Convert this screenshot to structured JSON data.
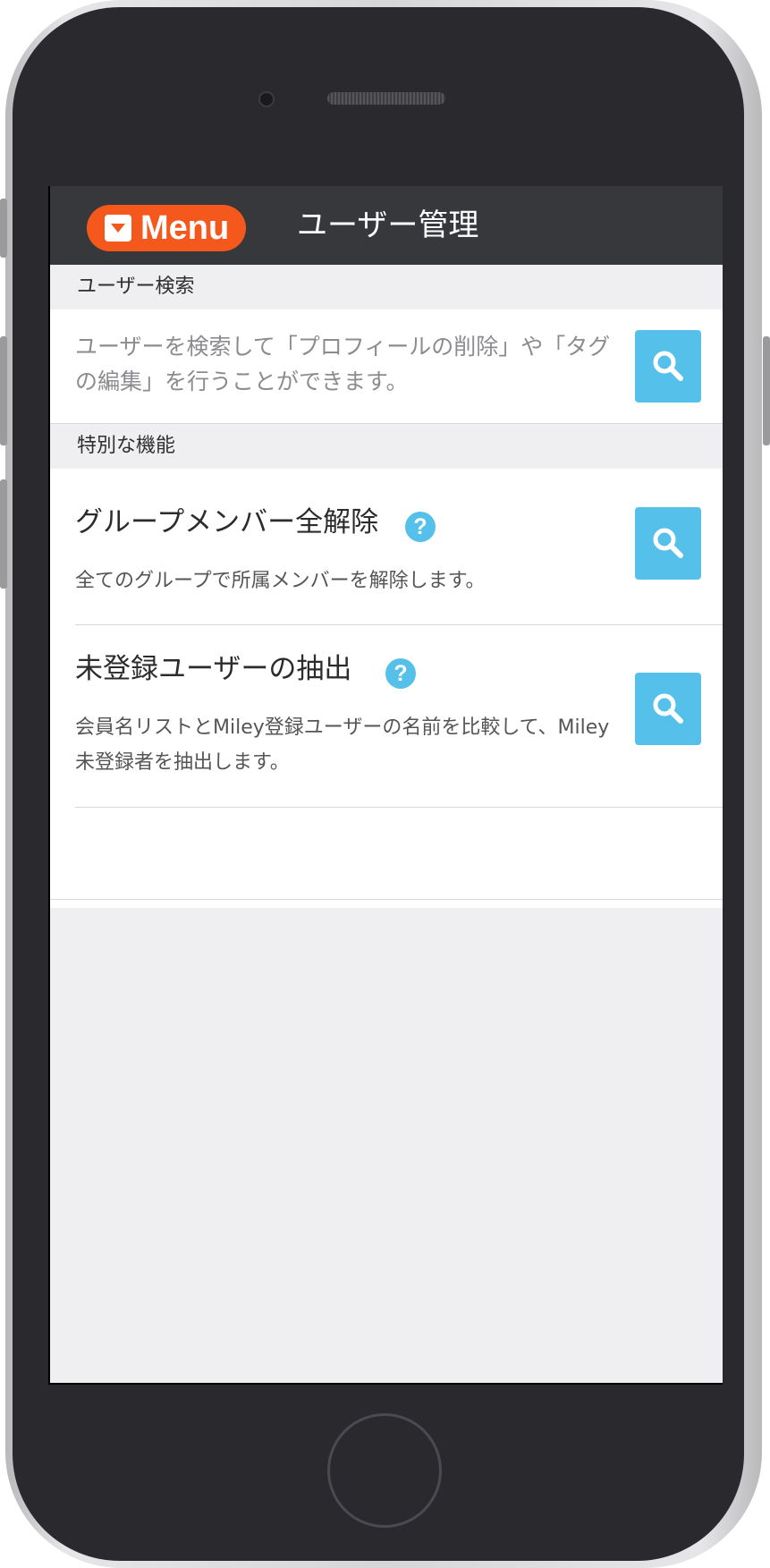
{
  "header": {
    "menu_label": "Menu",
    "title": "ユーザー管理"
  },
  "sections": {
    "user_search": {
      "heading": "ユーザー検索",
      "description": "ユーザーを検索して「プロフィールの削除」や「タグの編集」を行うことができます。"
    },
    "special": {
      "heading": "特別な機能",
      "items": [
        {
          "title": "グループメンバー全解除",
          "description": "全てのグループで所属メンバーを解除します。"
        },
        {
          "title": "未登録ユーザーの抽出",
          "description": "会員名リストとMiley登録ユーザーの名前を比較して、Miley未登録者を抽出します。"
        }
      ]
    }
  },
  "icons": {
    "help_glyph": "?",
    "menu": "chevron-down-square-icon",
    "search": "search-icon"
  },
  "colors": {
    "accent": "#f5581c",
    "button": "#55c0ea",
    "header_bg": "#36383c"
  }
}
